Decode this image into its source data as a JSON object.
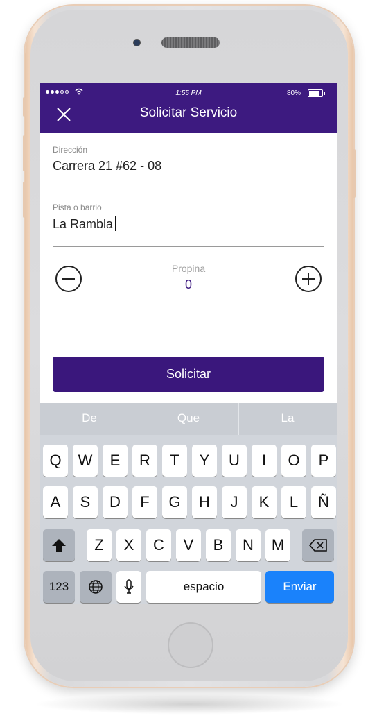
{
  "status_bar": {
    "time": "1:55 PM",
    "battery": "80%"
  },
  "header": {
    "title": "Solicitar Servicio"
  },
  "form": {
    "address_label": "Dirección",
    "address_value": "Carrera 21 #62 - 08",
    "neighborhood_label": "Pista o barrio",
    "neighborhood_value": "La Rambla"
  },
  "tip": {
    "label": "Propina",
    "value": "0"
  },
  "submit_label": "Solicitar",
  "keyboard": {
    "suggestions": [
      "De",
      "Que",
      "La"
    ],
    "row1": [
      "Q",
      "W",
      "E",
      "R",
      "T",
      "Y",
      "U",
      "I",
      "O",
      "P"
    ],
    "row2": [
      "A",
      "S",
      "D",
      "F",
      "G",
      "H",
      "J",
      "K",
      "L",
      "Ñ"
    ],
    "row3": [
      "Z",
      "X",
      "C",
      "V",
      "B",
      "N",
      "M"
    ],
    "num_label": "123",
    "space_label": "espacio",
    "send_label": "Enviar"
  },
  "colors": {
    "header": "#3d1a80",
    "primary": "#3a177c",
    "send": "#1a82fb"
  },
  "icons": [
    "close-icon",
    "minus-circle-icon",
    "plus-circle-icon",
    "shift-icon",
    "backspace-icon",
    "globe-icon",
    "microphone-icon"
  ]
}
